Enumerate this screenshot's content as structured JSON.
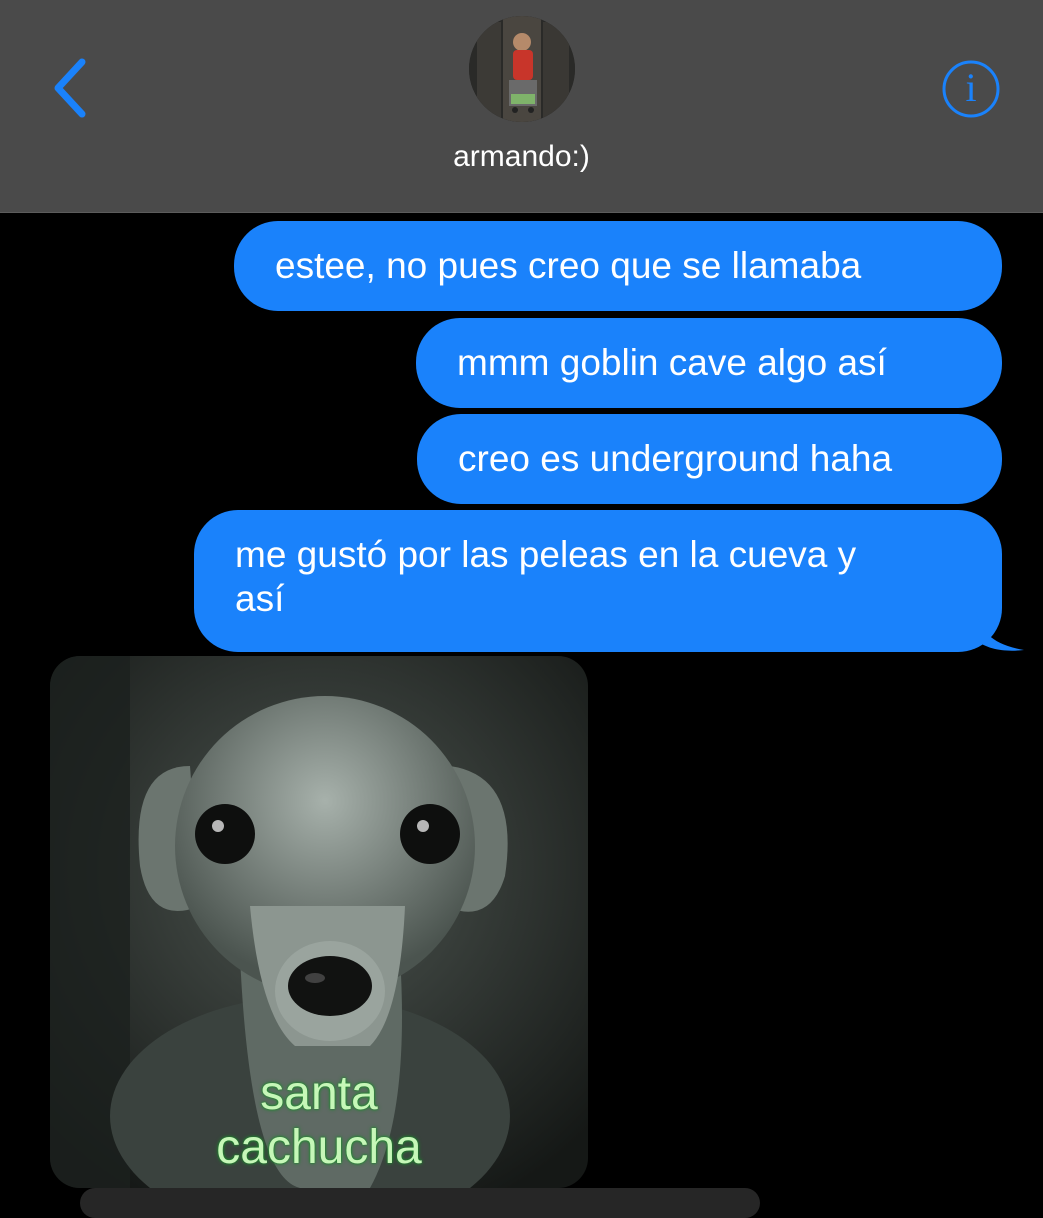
{
  "header": {
    "contact_name": "armando:)",
    "back_icon": "chevron-left-icon",
    "info_icon": "info-circle-icon",
    "info_glyph": "i"
  },
  "messages": [
    {
      "from": "me",
      "text": "estee, no pues creo que se llamaba"
    },
    {
      "from": "me",
      "text": "mmm goblin cave algo así"
    },
    {
      "from": "me",
      "text": "creo es underground haha"
    },
    {
      "from": "me",
      "lines": [
        "me gustó por las peleas en la cueva y",
        "así"
      ]
    },
    {
      "from": "them",
      "type": "image",
      "caption_lines": [
        "santa",
        "cachucha"
      ]
    }
  ],
  "colors": {
    "header_bg": "#4a4a4a",
    "accent": "#1a82fb",
    "bubble_sent": "#1a82fb",
    "background": "#000000",
    "caption_green": "#c6f7b8"
  }
}
